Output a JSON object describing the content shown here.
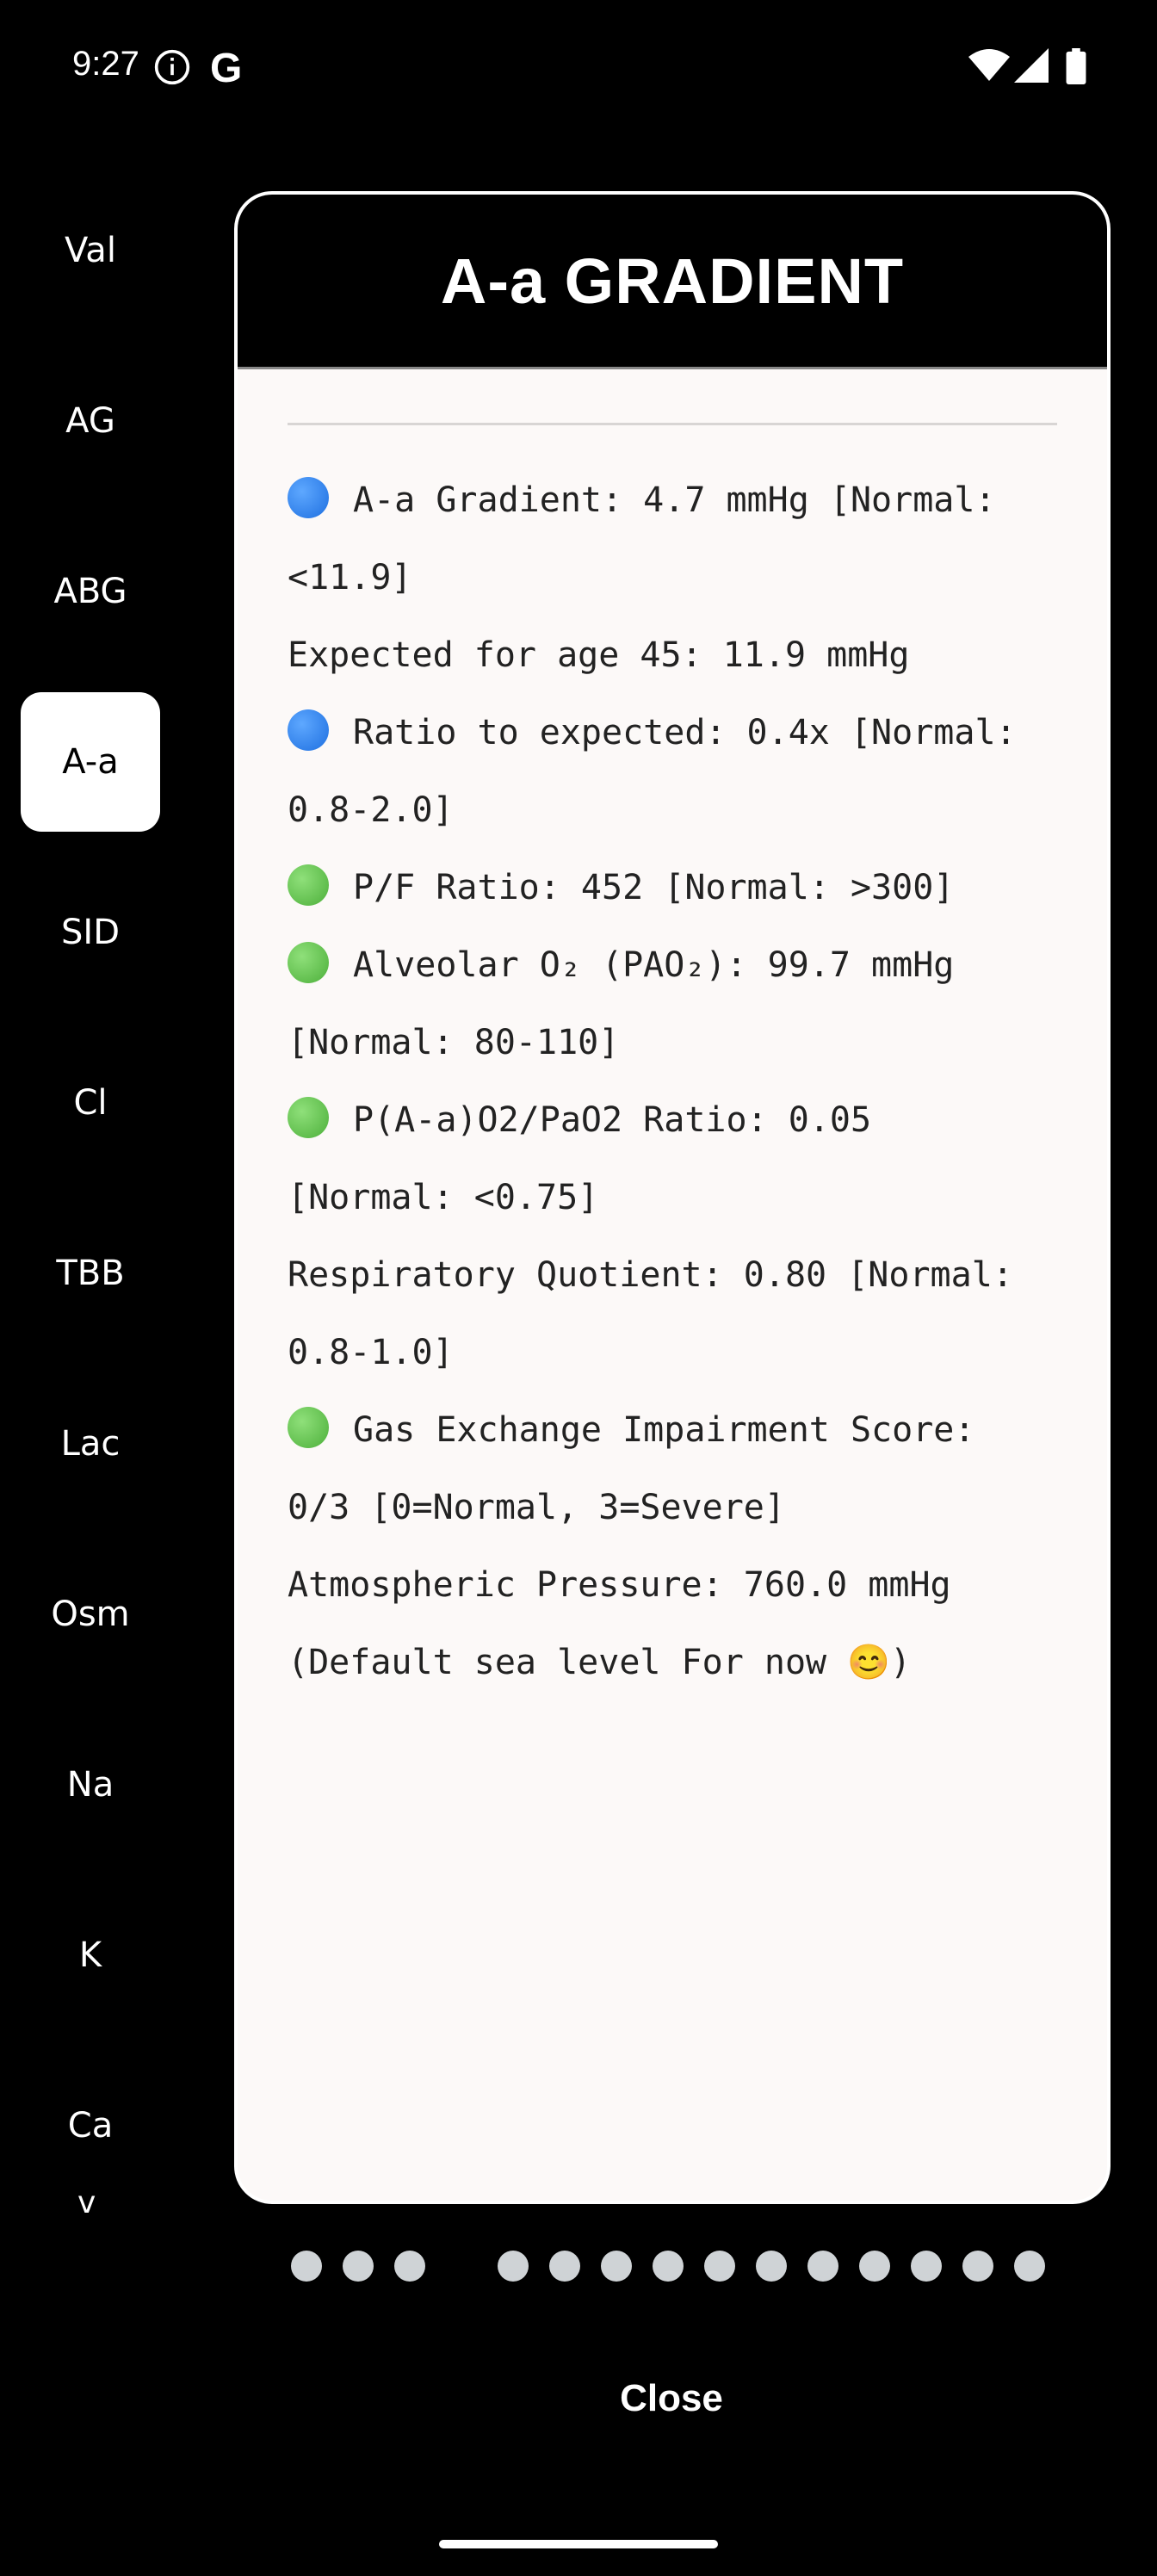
{
  "status_bar": {
    "time": "9:27",
    "info_icon": "info-circle-icon",
    "g_label": "G",
    "wifi_icon": "wifi-icon",
    "signal_icon": "cell-signal-icon",
    "battery_icon": "battery-icon"
  },
  "sidebar": {
    "items": [
      {
        "label": "Val",
        "active": false
      },
      {
        "label": "AG",
        "active": false
      },
      {
        "label": "ABG",
        "active": false
      },
      {
        "label": "A-a",
        "active": true
      },
      {
        "label": "SID",
        "active": false
      },
      {
        "label": "Cl",
        "active": false
      },
      {
        "label": "TBB",
        "active": false
      },
      {
        "label": "Lac",
        "active": false
      },
      {
        "label": "Osm",
        "active": false
      },
      {
        "label": "Na",
        "active": false
      },
      {
        "label": "K",
        "active": false
      },
      {
        "label": "Ca",
        "active": false
      }
    ],
    "more_chevron": "v"
  },
  "card": {
    "title": "A-a GRADIENT",
    "results": [
      {
        "indicator": "blue",
        "text": "A-a Gradient: 4.7 mmHg [Normal: <11.9]"
      },
      {
        "indicator": "",
        "text": "Expected for age 45: 11.9 mmHg"
      },
      {
        "indicator": "blue",
        "text": "Ratio to expected: 0.4x [Normal: 0.8-2.0]"
      },
      {
        "indicator": "green",
        "text": "P/F Ratio: 452 [Normal: >300]"
      },
      {
        "indicator": "green",
        "text": "Alveolar O₂ (PAO₂): 99.7 mmHg [Normal: 80-110]"
      },
      {
        "indicator": "green",
        "text": "P(A-a)O2/PaO2 Ratio: 0.05 [Normal: <0.75]"
      },
      {
        "indicator": "",
        "text": "Respiratory Quotient: 0.80 [Normal: 0.8-1.0]"
      },
      {
        "indicator": "green",
        "text": "Gas Exchange Impairment Score: 0/3 [0=Normal, 3=Severe]"
      },
      {
        "indicator": "",
        "text": "Atmospheric Pressure: 760.0 mmHg (Default sea level For now 😊)"
      }
    ]
  },
  "pager": {
    "total_dots": 14,
    "current_page": 4
  },
  "close_label": "Close",
  "colors": {
    "background": "#000000",
    "card": "#fcf9f8",
    "blue_indicator": "#1e6fe0",
    "green_indicator": "#4caf3a"
  }
}
